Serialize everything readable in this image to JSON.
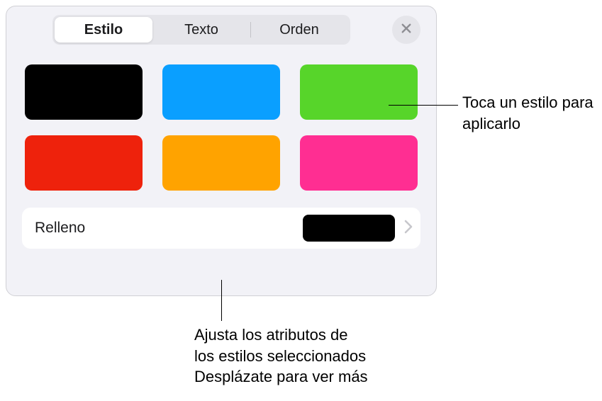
{
  "tabs": {
    "style": "Estilo",
    "text": "Texto",
    "order": "Orden"
  },
  "swatches": [
    {
      "color": "#000000"
    },
    {
      "color": "#0A9FFF"
    },
    {
      "color": "#57D52A"
    },
    {
      "color": "#EE220C"
    },
    {
      "color": "#FFA300"
    },
    {
      "color": "#FF2E92"
    }
  ],
  "fill": {
    "label": "Relleno",
    "preview_color": "#000000"
  },
  "callouts": {
    "apply": "Toca un estilo para aplicarlo",
    "attributes_line1": "Ajusta los atributos de",
    "attributes_line2": "los estilos seleccionados",
    "attributes_line3": "Desplázate para ver más"
  }
}
